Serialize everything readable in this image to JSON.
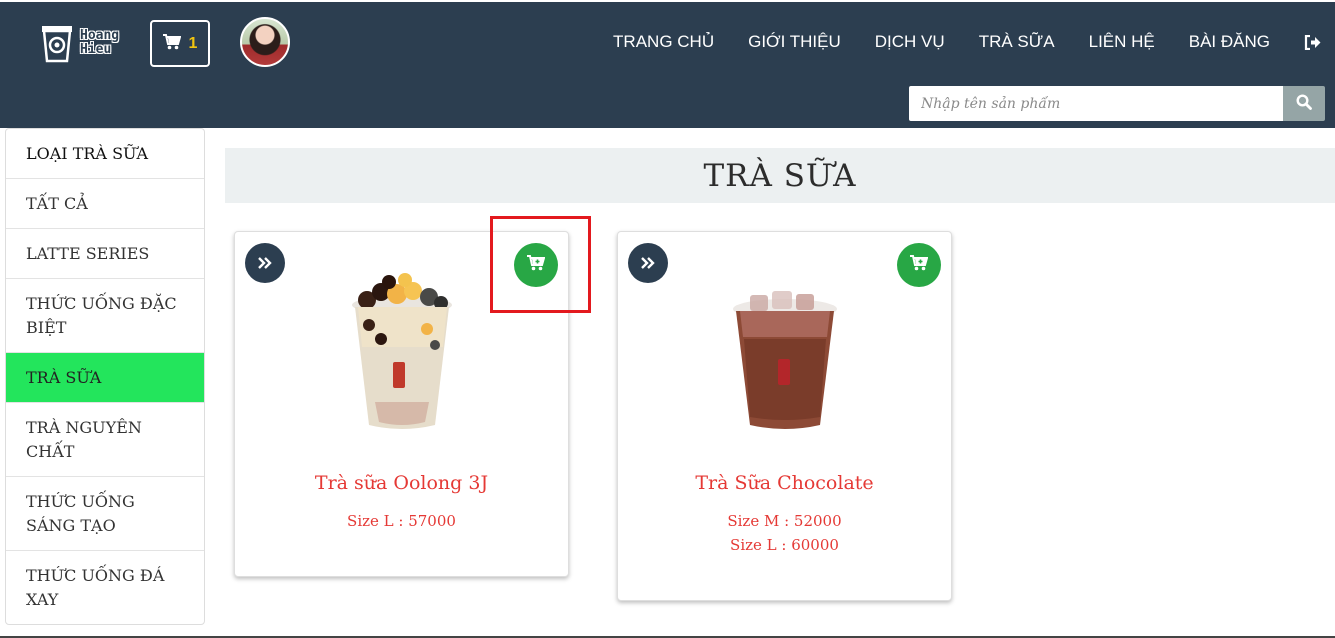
{
  "header": {
    "logo_text_line1": "Hoang",
    "logo_text_line2": "Hieu",
    "cart_count": "1",
    "nav": [
      "TRANG CHỦ",
      "GIỚI THIỆU",
      "DỊCH VỤ",
      "TRÀ SỮA",
      "LIÊN HỆ",
      "BÀI ĐĂNG"
    ],
    "search_placeholder": "Nhập tên sản phẩm",
    "colors": {
      "bar": "#2c3e50",
      "cart_count": "#f1c40f"
    }
  },
  "sidebar": {
    "items": [
      {
        "label": "LOẠI TRÀ SỮA"
      },
      {
        "label": "TẤT CẢ"
      },
      {
        "label": "LATTE SERIES"
      },
      {
        "label": "THỨC UỐNG ĐẶC BIỆT"
      },
      {
        "label": "TRÀ SỮA"
      },
      {
        "label": "TRÀ NGUYÊN CHẤT"
      },
      {
        "label": "THỨC UỐNG SÁNG TẠO"
      },
      {
        "label": "THỨC UỐNG ĐÁ XAY"
      }
    ],
    "active_color": "#23e55c"
  },
  "main": {
    "title": "TRÀ SỮA",
    "products": [
      {
        "name": "Trà sữa Oolong 3J",
        "sizes": [
          "Size L : 57000"
        ]
      },
      {
        "name": "Trà Sữa Chocolate",
        "sizes": [
          "Size M : 52000",
          "Size L : 60000"
        ]
      }
    ],
    "colors": {
      "price": "#e53935",
      "add_cart": "#28a745",
      "highlight": "#e3191e"
    }
  }
}
